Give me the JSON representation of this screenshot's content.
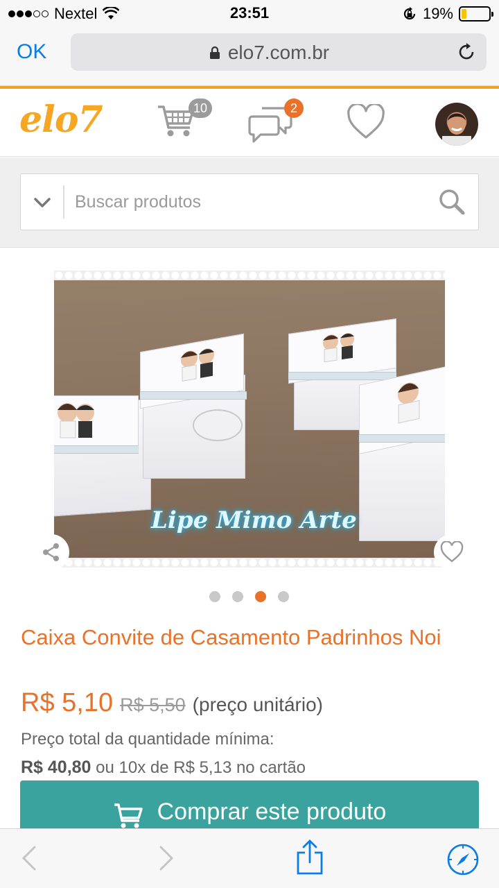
{
  "status": {
    "carrier": "Nextel",
    "time": "23:51",
    "battery_percent": "19%",
    "battery_level": 0.19
  },
  "browser": {
    "done_label": "OK",
    "url": "elo7.com.br"
  },
  "header": {
    "logo_text": "elo7",
    "cart_count": "10",
    "messages_count": "2",
    "accent_color": "#f5a623"
  },
  "search": {
    "placeholder": "Buscar produtos",
    "value": ""
  },
  "product": {
    "image_watermark": "Lipe Mimo Arte",
    "carousel_total": 4,
    "carousel_active": 3,
    "title": "Caixa Convite de Casamento Padrinhos Noi",
    "price": "R$ 5,10",
    "old_price": "R$ 5,50",
    "unit_note": "(preço unitário)",
    "total_label": "Preço total da quantidade mínima:",
    "total_value": "R$ 40,80",
    "installments": "ou 10x de R$ 5,13 no cartão",
    "buy_label": "Comprar este produto",
    "brand_color": "#e8722a",
    "buy_color": "#3aa39e"
  }
}
